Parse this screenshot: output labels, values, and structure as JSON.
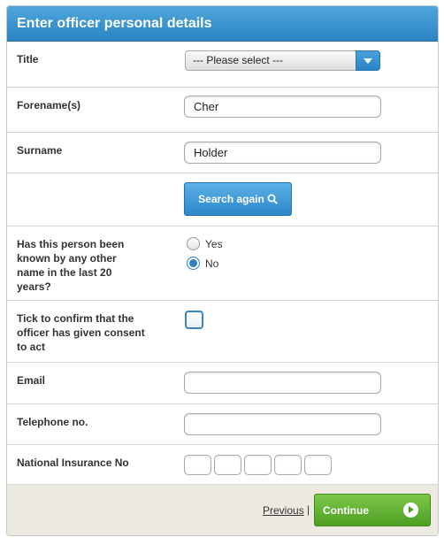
{
  "form": {
    "title": "Enter officer personal details",
    "title_field": {
      "label": "Title",
      "selected": "--- Please select ---"
    },
    "forenames": {
      "label": "Forename(s)",
      "value": "Cher"
    },
    "surname": {
      "label": "Surname",
      "value": "Holder"
    },
    "search_button": {
      "label": "Search again",
      "icon": "search-icon"
    },
    "other_names": {
      "label": "Has this person been known by any other name in the last 20 years?",
      "options": [
        {
          "label": "Yes",
          "selected": false
        },
        {
          "label": "No",
          "selected": true
        }
      ]
    },
    "consent": {
      "label": "Tick to confirm that the officer has given consent to act",
      "checked": false
    },
    "email": {
      "label": "Email",
      "value": ""
    },
    "telephone": {
      "label": "Telephone no.",
      "value": ""
    },
    "ni_number": {
      "label": "National Insurance No",
      "segments": [
        "",
        "",
        "",
        "",
        ""
      ]
    }
  },
  "footer": {
    "previous_label": "Previous",
    "separator": "|",
    "continue_label": "Continue",
    "continue_icon": "arrow-right-circle-icon"
  },
  "colors": {
    "header_blue": "#2b84c4",
    "button_blue": "#3d98d6",
    "continue_green": "#5eab2e",
    "footer_bg": "#ece9e1"
  }
}
